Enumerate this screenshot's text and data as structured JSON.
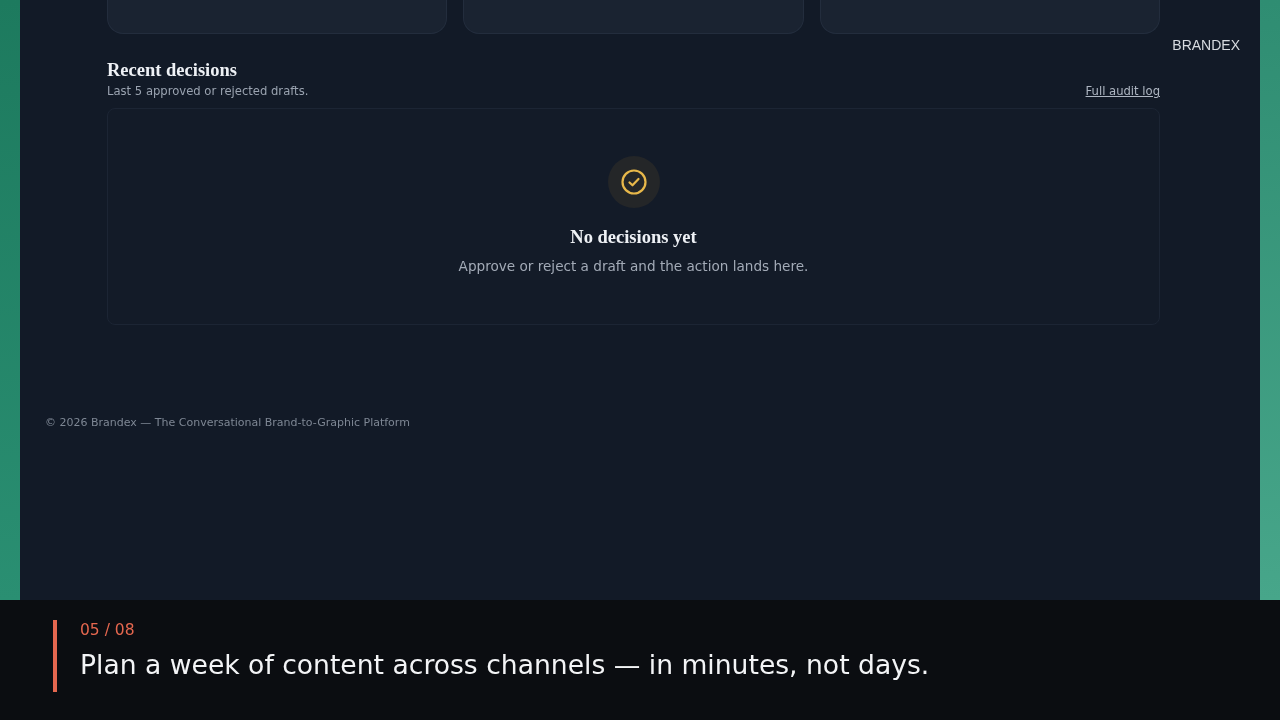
{
  "brand_label": "BRANDEX",
  "recent_decisions": {
    "title": "Recent decisions",
    "subtitle": "Last 5 approved or rejected drafts.",
    "link": "Full audit log",
    "empty_state": {
      "title": "No decisions yet",
      "message": "Approve or reject a draft and the action lands here."
    }
  },
  "footer": "© 2026 Brandex — The Conversational Brand-to-Graphic Platform",
  "caption": {
    "counter": "05 / 08",
    "text": "Plan a week of content across channels — in minutes, not days."
  }
}
